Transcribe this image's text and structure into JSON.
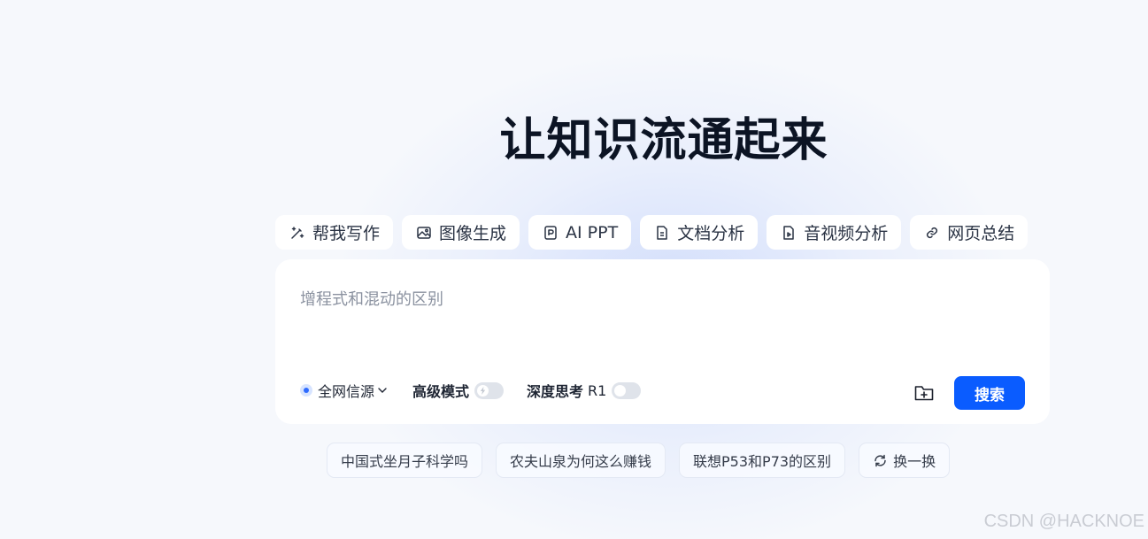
{
  "hero": {
    "title": "让知识流通起来"
  },
  "tools": [
    {
      "label": "帮我写作",
      "icon": "magic-wand-icon"
    },
    {
      "label": "图像生成",
      "icon": "image-icon"
    },
    {
      "label": "AI PPT",
      "icon": "slides-icon"
    },
    {
      "label": "文档分析",
      "icon": "document-icon"
    },
    {
      "label": "音视频分析",
      "icon": "media-file-icon"
    },
    {
      "label": "网页总结",
      "icon": "link-icon"
    }
  ],
  "search": {
    "placeholder": "增程式和混动的区别",
    "source_label": "全网信源",
    "advanced_label": "高级模式",
    "advanced_enabled": false,
    "deep_think_label": "深度思考",
    "deep_think_model": "R1",
    "deep_think_enabled": false,
    "submit_label": "搜索"
  },
  "suggestions": [
    "中国式坐月子科学吗",
    "农夫山泉为何这么赚钱",
    "联想P53和P73的区别"
  ],
  "refresh_label": "换一换",
  "watermark": "CSDN @HACKNOE",
  "colors": {
    "accent": "#0a5cff",
    "title": "#0c1424",
    "background": "#f6f8fc"
  }
}
